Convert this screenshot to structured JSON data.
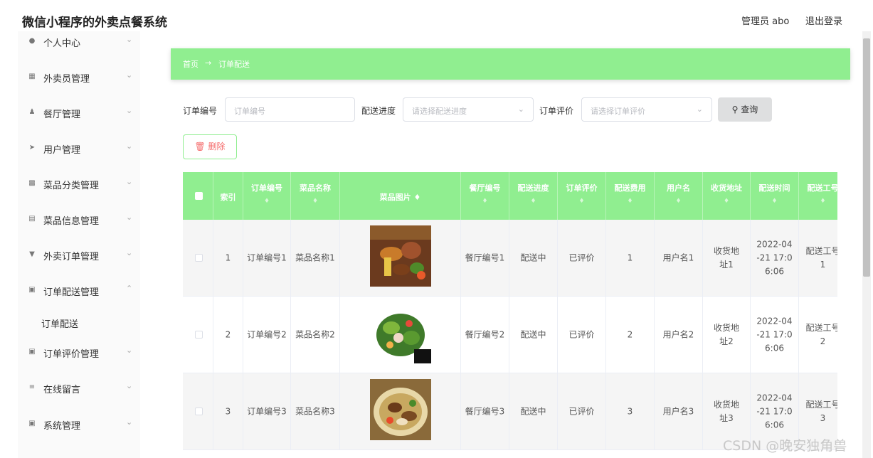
{
  "app": {
    "title": "微信小程序的外卖点餐系统"
  },
  "header": {
    "admin": "管理员 abo",
    "logout": "退出登录"
  },
  "sidebar": {
    "items": [
      {
        "label": "个人中心",
        "icon": "user-icon"
      },
      {
        "label": "外卖员管理",
        "icon": "grid-icon"
      },
      {
        "label": "餐厅管理",
        "icon": "person-icon"
      },
      {
        "label": "用户管理",
        "icon": "send-icon"
      },
      {
        "label": "菜品分类管理",
        "icon": "image-icon"
      },
      {
        "label": "菜品信息管理",
        "icon": "document-icon"
      },
      {
        "label": "外卖订单管理",
        "icon": "cup-icon"
      },
      {
        "label": "订单配送管理",
        "icon": "apps-icon"
      },
      {
        "label": "订单评价管理",
        "icon": "apps-icon"
      },
      {
        "label": "在线留言",
        "icon": "list-icon"
      },
      {
        "label": "系统管理",
        "icon": "apps-icon"
      }
    ],
    "active_sub": "订单配送"
  },
  "breadcrumb": {
    "home": "首页",
    "sep": "→",
    "current": "订单配送"
  },
  "filters": {
    "order_no_label": "订单编号",
    "order_no_placeholder": "订单编号",
    "progress_label": "配送进度",
    "progress_placeholder": "请选择配送进度",
    "rating_label": "订单评价",
    "rating_placeholder": "请选择订单评价",
    "query_button": "查询",
    "delete_button": "删除"
  },
  "table": {
    "columns": [
      "索引",
      "订单编号",
      "菜品名称",
      "菜品图片",
      "餐厅编号",
      "配送进度",
      "订单评价",
      "配送费用",
      "用户名",
      "收货地址",
      "配送时间",
      "配送工号"
    ],
    "rows": [
      {
        "index": "1",
        "order_no": "订单编号1",
        "dish": "菜品名称1",
        "restaurant": "餐厅编号1",
        "progress": "配送中",
        "rating": "已评价",
        "fee": "1",
        "user": "用户名1",
        "address": "收货地址1",
        "time": "2022-04-21 17:06:06",
        "worker": "配送工号1"
      },
      {
        "index": "2",
        "order_no": "订单编号2",
        "dish": "菜品名称2",
        "restaurant": "餐厅编号2",
        "progress": "配送中",
        "rating": "已评价",
        "fee": "2",
        "user": "用户名2",
        "address": "收货地址2",
        "time": "2022-04-21 17:06:06",
        "worker": "配送工号2"
      },
      {
        "index": "3",
        "order_no": "订单编号3",
        "dish": "菜品名称3",
        "restaurant": "餐厅编号3",
        "progress": "配送中",
        "rating": "已评价",
        "fee": "3",
        "user": "用户名3",
        "address": "收货地址3",
        "time": "2022-04-21 17:06:06",
        "worker": "配送工号3"
      }
    ]
  },
  "watermark": "CSDN @晚安独角兽",
  "colors": {
    "accent": "#90ee90",
    "danger": "#f56c6c"
  }
}
